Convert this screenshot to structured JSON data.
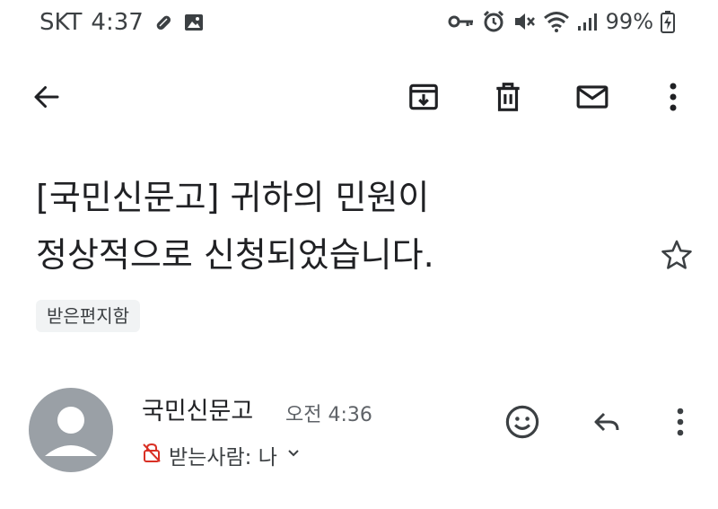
{
  "status_bar": {
    "carrier": "SKT",
    "time": "4:37",
    "battery": "99%",
    "icons": [
      "attachment-icon",
      "image-icon",
      "key-icon",
      "alarm-icon",
      "mute-icon",
      "wifi-icon",
      "signal-icon",
      "battery-charging-icon"
    ]
  },
  "toolbar": {
    "icons": [
      "back-arrow-icon",
      "archive-icon",
      "trash-icon",
      "mail-icon",
      "more-vertical-icon"
    ]
  },
  "email": {
    "subject_line1": "[국민신문고] 귀하의 민원이",
    "subject_line2": "정상적으로 신청되었습니다.",
    "label": "받은편지함",
    "sender": "국민신문고",
    "time": "오전 4:36",
    "recipient": "받는사람: 나"
  },
  "colors": {
    "text": "#202124",
    "secondary": "#5f6368",
    "avatar": "#9aa0a6",
    "chip": "#f1f3f4",
    "privacy_icon": "#d93025"
  }
}
